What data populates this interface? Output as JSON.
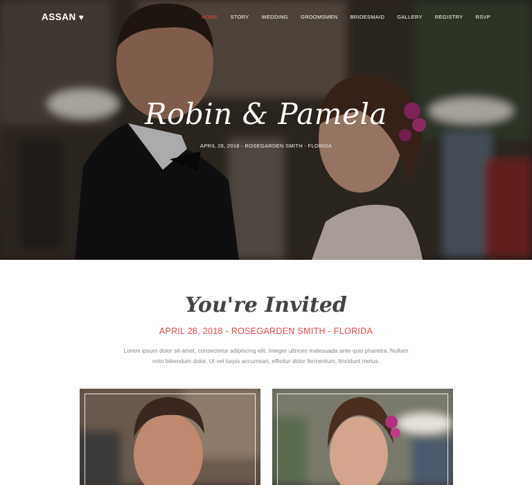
{
  "nav": {
    "logo": "ASSAN",
    "items": [
      "HOME",
      "STORY",
      "WEDDING",
      "GROOMSMEN",
      "BRIDESMAID",
      "GALLERY",
      "REGISTRY",
      "RSVP"
    ],
    "active_color": "#e84a4a"
  },
  "hero": {
    "title": "Robin & Pamela",
    "subtitle": "APRIL 28, 2018 - ROSEGARDEN SMITH - FLORIDA"
  },
  "invite": {
    "title": "You're Invited",
    "date": "APRIL 28, 2018 - ROSEGARDEN SMITH - FLORIDA",
    "text": "Lorem ipsum dolor sit amet, consectetur adipiscing elit. Integer ultrices malesuada ante quis pharetra. Nullam notn bibendum dolor. Ut vel turpis accumsan, efficitur dolor fermentum, tincidunt metus."
  },
  "colors": {
    "accent": "#e84a4a",
    "text_muted": "#8a8a8a"
  }
}
